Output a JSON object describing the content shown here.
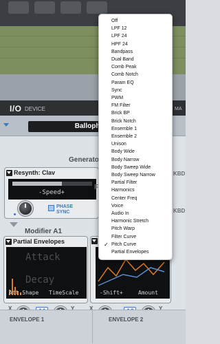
{
  "device_header": {
    "title": "I/O",
    "subtitle": "DEVICE",
    "right_label": "MA"
  },
  "preset": {
    "name": "Ballophone"
  },
  "generator": {
    "section_label": "Generator",
    "resynth_title": "Resynth: Clav",
    "screen_value": "-Speed+",
    "phase_sync_label": "PHASE SYNC"
  },
  "modifier": {
    "section_label": "Modifier A1",
    "partial_envelopes_title": "Partial Envelopes",
    "attack_label": "Attack",
    "decay_label": "Decay",
    "att_shape_label": "Att.Shape",
    "timescale_label": "TimeScale",
    "shift_label": "-Shift+",
    "amount_label": "Amount",
    "ab_left": "A1",
    "ab_right": "A2",
    "x_label": "X",
    "y_label": "Y"
  },
  "side_labels": {
    "kbd_top": "KBD",
    "kbd_bottom": "KBD",
    "f_label": "F"
  },
  "envelopes": {
    "env1": "ENVELOPE 1",
    "env2": "ENVELOPE 2"
  },
  "filter_menu": {
    "selected": "Pitch Curve",
    "items": [
      "Off",
      "LPF 12",
      "LPF 24",
      "HPF 24",
      "Bandpass",
      "Dual Band",
      "Comb Peak",
      "Comb Notch",
      "Param EQ",
      "Sync",
      "PWM",
      "FM Filter",
      "Brick BP",
      "Brick Notch",
      "Ensemble 1",
      "Ensemble 2",
      "Unison",
      "Body Wide",
      "Body Narrow",
      "Body Sweep Wide",
      "Body Sweep Narrow",
      "Partial Filter",
      "Harmonics",
      "Center Freq",
      "Voice",
      "Audio In",
      "Harmonic Stretch",
      "Pitch Warp",
      "Filter Curve",
      "Pitch Curve",
      "Partial Envelopes"
    ]
  },
  "colors": {
    "accent": "#3a79c2",
    "menu_bg": "#ffffff"
  }
}
